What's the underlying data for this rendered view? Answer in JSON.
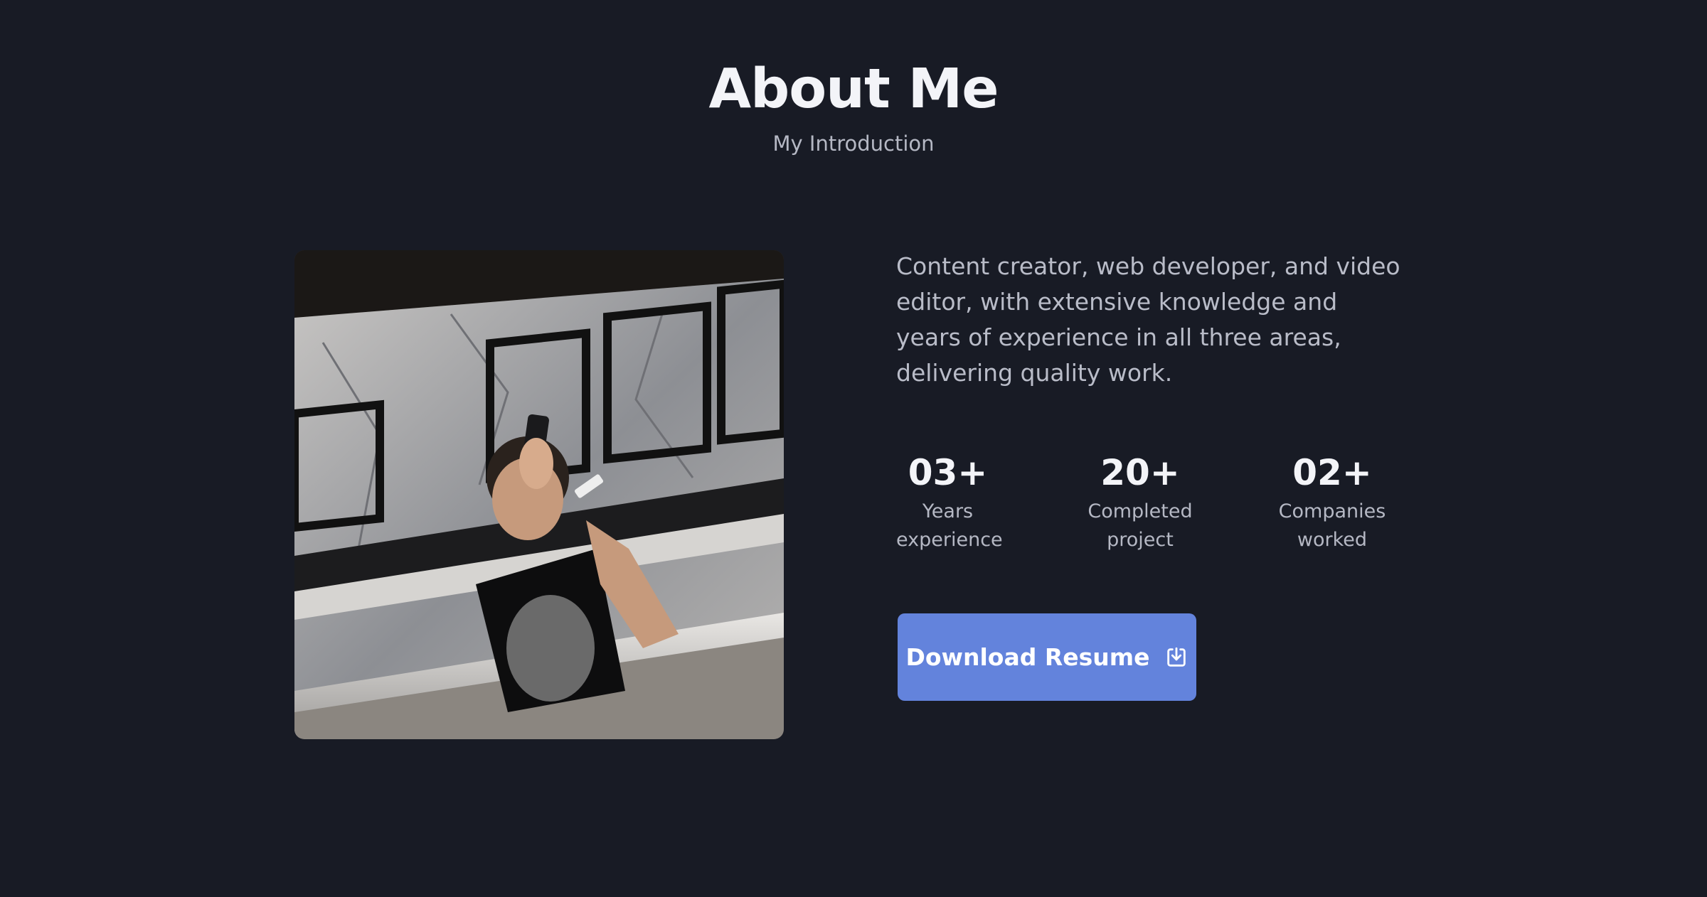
{
  "header": {
    "title": "About Me",
    "subtitle": "My Introduction"
  },
  "about": {
    "description": "Content creator, web developer, and video editor, with extensive knowledge and years of experience in all three areas, delivering quality work.",
    "photo_icon": "profile-photo-mirror-selfie"
  },
  "stats": [
    {
      "value": "03+",
      "label_line1": "Years",
      "label_line2": "experience"
    },
    {
      "value": "20+",
      "label_line1": "Completed",
      "label_line2": "project"
    },
    {
      "value": "02+",
      "label_line1": "Companies",
      "label_line2": "worked"
    }
  ],
  "actions": {
    "download_label": "Download Resume",
    "download_icon": "download-icon"
  },
  "colors": {
    "background": "#181b25",
    "accent": "#6383dc",
    "text": "#ecedf2",
    "muted": "#b5b8c4"
  }
}
